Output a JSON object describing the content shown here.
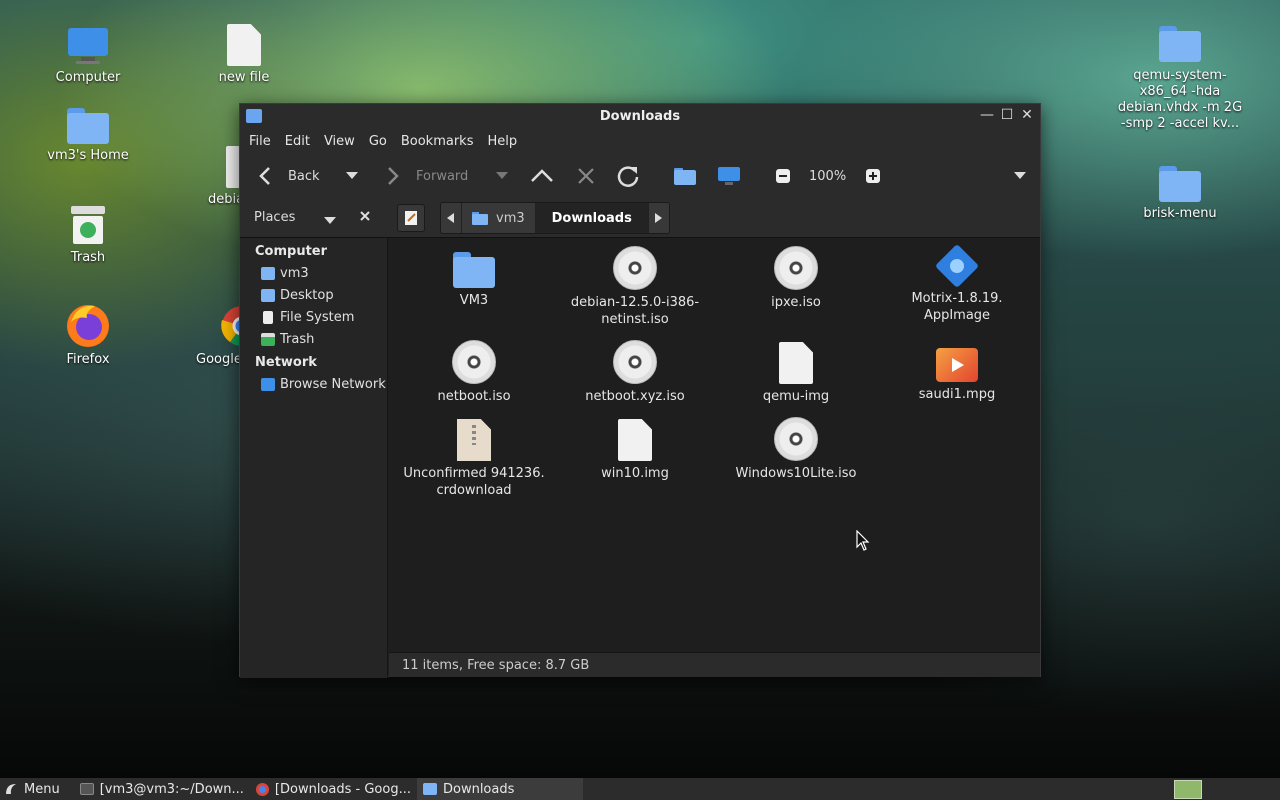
{
  "desktop": {
    "icons_left": [
      {
        "label": "Computer",
        "icon": "computer-icon"
      },
      {
        "label": "vm3's Home",
        "icon": "home-folder-icon"
      },
      {
        "label": "Trash",
        "icon": "trash-icon"
      },
      {
        "label": "Firefox",
        "icon": "firefox-icon"
      }
    ],
    "icons_col2": [
      {
        "label": "new file",
        "icon": "file-icon"
      },
      {
        "label": "debia",
        "icon": "file-icon"
      },
      {
        "label": "Google",
        "icon": "chrome-icon"
      }
    ],
    "icons_right": [
      {
        "label": "qemu-system-x86_64 -hda debian.vhdx -m 2G -smp 2 -accel kv...",
        "icon": "folder-icon"
      },
      {
        "label": "brisk-menu",
        "icon": "folder-icon"
      }
    ]
  },
  "window": {
    "title": "Downloads",
    "menu": [
      "File",
      "Edit",
      "View",
      "Go",
      "Bookmarks",
      "Help"
    ],
    "toolbar": {
      "back": "Back",
      "forward": "Forward",
      "zoom": "100%"
    },
    "navbar": {
      "places": "Places",
      "crumbs": [
        "vm3",
        "Downloads"
      ]
    },
    "sidebar": {
      "computer_head": "Computer",
      "computer_items": [
        "vm3",
        "Desktop",
        "File System",
        "Trash"
      ],
      "network_head": "Network",
      "network_items": [
        "Browse Network"
      ]
    },
    "files": [
      {
        "line1": "VM3",
        "line2": "",
        "icon": "folder-icon"
      },
      {
        "line1": "debian-12.5.0-i386-",
        "line2": "netinst.iso",
        "icon": "disc-icon"
      },
      {
        "line1": "ipxe.iso",
        "line2": "",
        "icon": "disc-icon"
      },
      {
        "line1": "Motrix-1.8.19.",
        "line2": "AppImage",
        "icon": "appimage-icon"
      },
      {
        "line1": "netboot.iso",
        "line2": "",
        "icon": "disc-icon"
      },
      {
        "line1": "netboot.xyz.iso",
        "line2": "",
        "icon": "disc-icon"
      },
      {
        "line1": "qemu-img",
        "line2": "",
        "icon": "file-icon"
      },
      {
        "line1": "saudi1.mpg",
        "line2": "",
        "icon": "video-icon"
      },
      {
        "line1": "Unconfirmed 941236.",
        "line2": "crdownload",
        "icon": "archive-icon"
      },
      {
        "line1": "win10.img",
        "line2": "",
        "icon": "file-icon"
      },
      {
        "line1": "Windows10Lite.iso",
        "line2": "",
        "icon": "disc-icon"
      }
    ],
    "status": "11 items, Free space: 8.7 GB"
  },
  "panel": {
    "menu": "Menu",
    "tasks": [
      "[vm3@vm3:~/Down...",
      "[Downloads - Goog...",
      "Downloads"
    ]
  }
}
